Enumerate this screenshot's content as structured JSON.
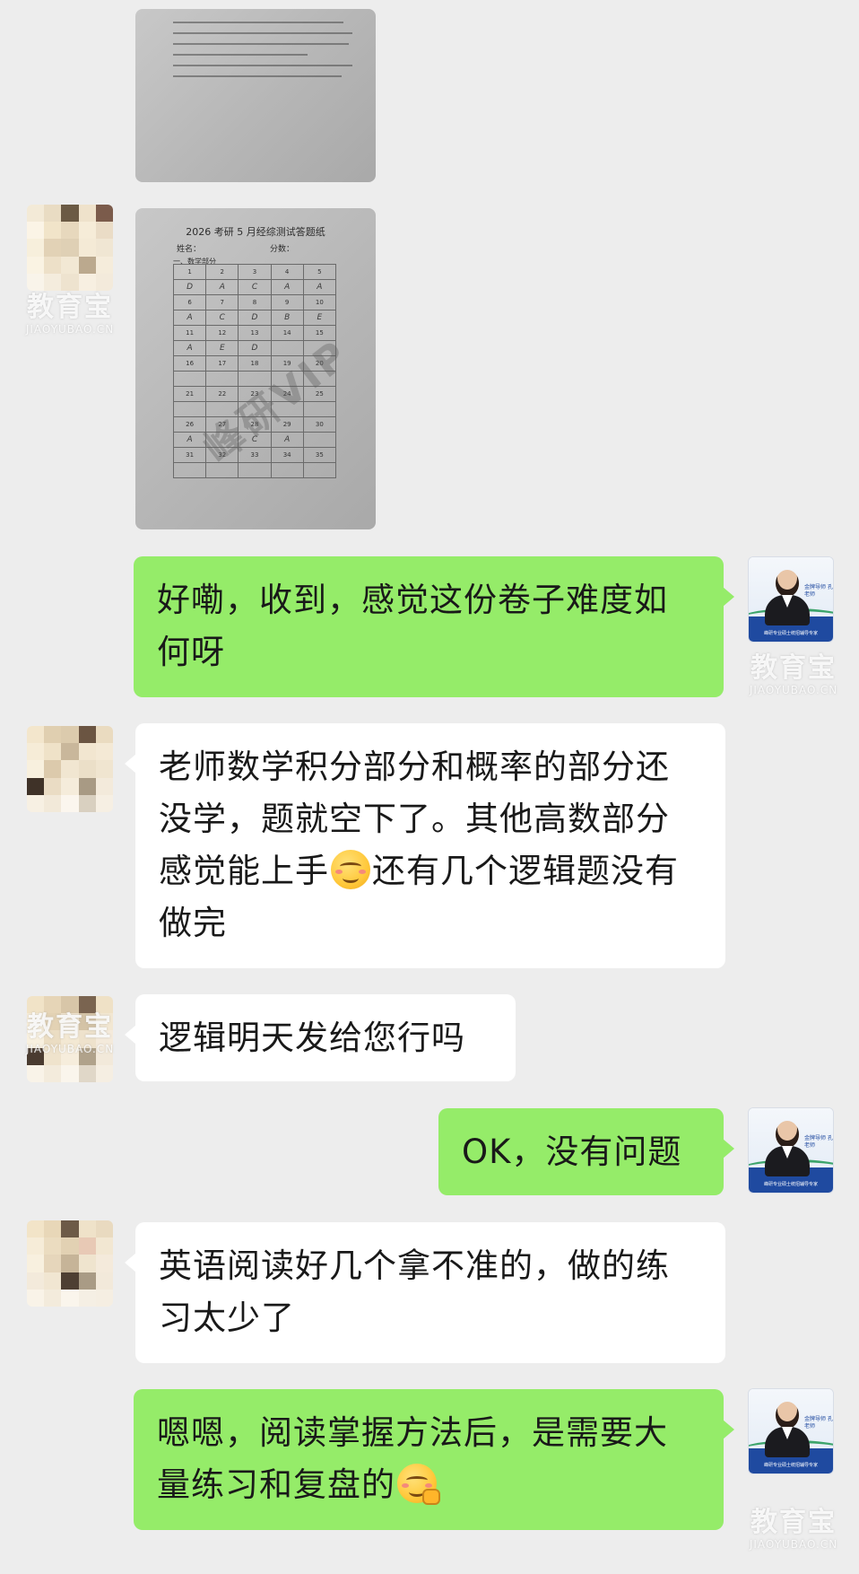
{
  "conversation": {
    "messages": [
      {
        "id": "m1",
        "kind": "image",
        "side": "left",
        "content": "handwritten-notes-photo"
      },
      {
        "id": "m2",
        "kind": "image",
        "side": "left",
        "content": "answer-sheet-photo"
      },
      {
        "id": "m3",
        "kind": "text",
        "side": "right",
        "text": "好嘞，收到，感觉这份卷子难度如何呀"
      },
      {
        "id": "m4",
        "kind": "text",
        "side": "left",
        "text_before_emoji": "老师数学积分部分和概率的部分还没学，题就空下了。其他高数部分感觉能上手",
        "emoji": "smiling-face-icon",
        "text_after_emoji": "还有几个逻辑题没有做完"
      },
      {
        "id": "m5",
        "kind": "text",
        "side": "left",
        "text": "逻辑明天发给您行吗"
      },
      {
        "id": "m6",
        "kind": "text",
        "side": "right",
        "text": "OK，没有问题"
      },
      {
        "id": "m7",
        "kind": "text",
        "side": "left",
        "text": "英语阅读好几个拿不准的，做的练习太少了"
      },
      {
        "id": "m8",
        "kind": "text",
        "side": "right",
        "text": "嗯嗯，阅读掌握方法后，是需要大量练习和复盘的",
        "emoji": "salute-face-icon"
      }
    ]
  },
  "answer_sheet": {
    "title": "2026 考研 5 月经综测试答题纸",
    "name_label": "姓名：",
    "score_label": "分数：",
    "section_label": "一、数学部分",
    "stamp": "峰研VIP",
    "rows": [
      {
        "numbers": [
          "1",
          "2",
          "3",
          "4",
          "5"
        ],
        "answers": [
          "D",
          "A",
          "C",
          "A",
          "A"
        ]
      },
      {
        "numbers": [
          "6",
          "7",
          "8",
          "9",
          "10"
        ],
        "answers": [
          "A",
          "C",
          "D",
          "B",
          "E"
        ]
      },
      {
        "numbers": [
          "11",
          "12",
          "13",
          "14",
          "15"
        ],
        "answers": [
          "A",
          "E",
          "D",
          "",
          ""
        ]
      },
      {
        "numbers": [
          "16",
          "17",
          "18",
          "19",
          "20"
        ],
        "answers": [
          "",
          "",
          "",
          "",
          ""
        ]
      },
      {
        "numbers": [
          "21",
          "22",
          "23",
          "24",
          "25"
        ],
        "answers": [
          "",
          "",
          "",
          "",
          ""
        ]
      },
      {
        "numbers": [
          "26",
          "27",
          "28",
          "29",
          "30"
        ],
        "answers": [
          "A",
          "",
          "C",
          "A",
          ""
        ]
      },
      {
        "numbers": [
          "31",
          "32",
          "33",
          "34",
          "35"
        ],
        "answers": [
          "",
          "",
          "",
          "",
          ""
        ]
      }
    ]
  },
  "teacher_avatar": {
    "label": "金牌导师 孔老师",
    "caption": "峰研专业硕士统招辅导专家"
  },
  "watermark": {
    "cn": "教育宝",
    "en": "JIAOYUBAO.CN"
  },
  "colors": {
    "background": "#ededed",
    "bubble_out": "#95ec69",
    "bubble_in": "#ffffff",
    "text": "#191919"
  }
}
